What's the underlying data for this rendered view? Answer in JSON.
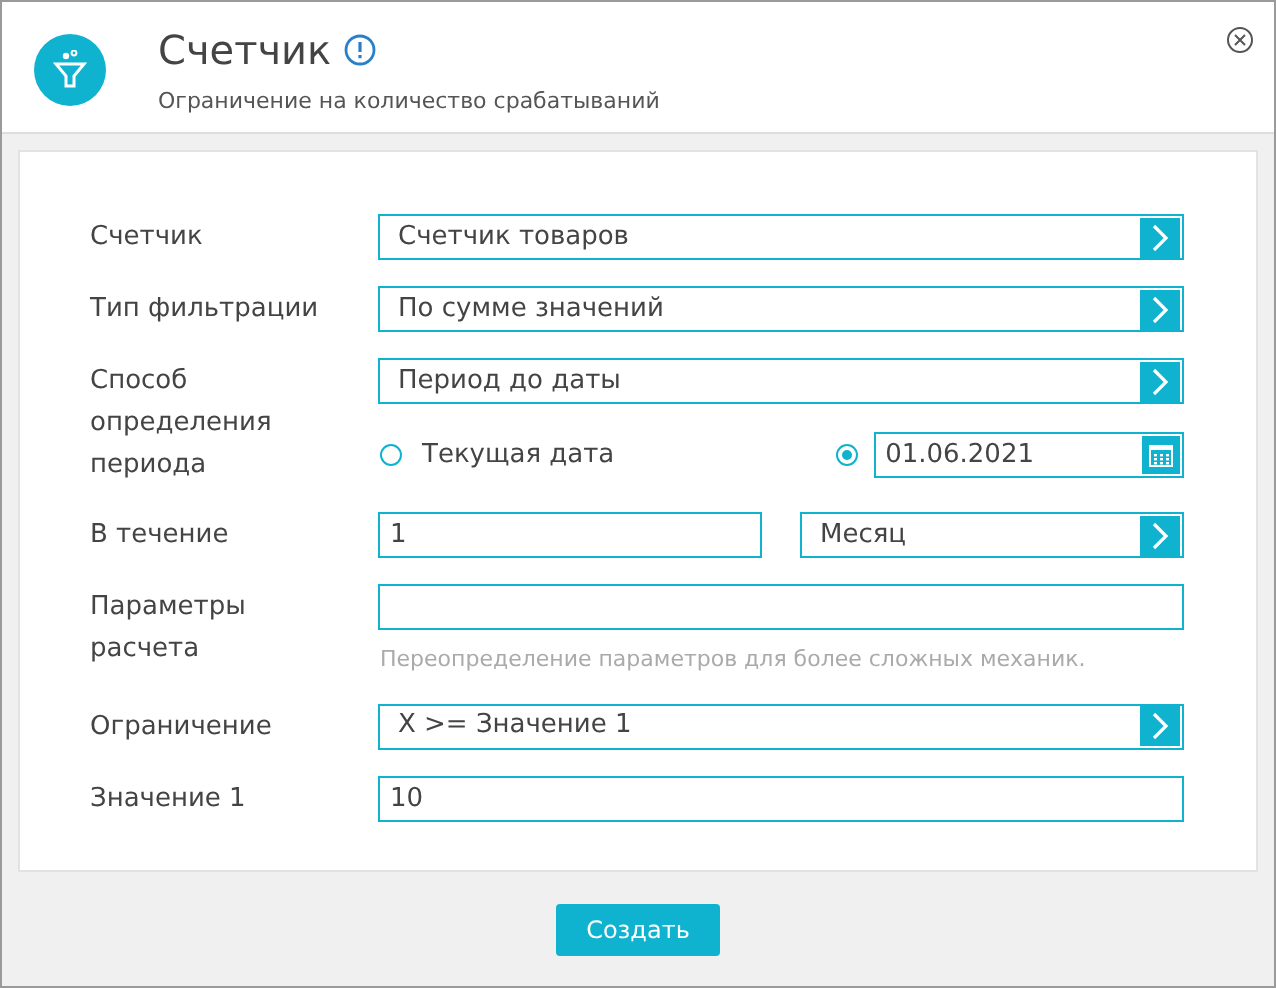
{
  "header": {
    "title": "Счетчик",
    "subtitle": "Ограничение на количество срабатываний"
  },
  "rows": [
    {
      "kind": "select",
      "label": "Счетчик",
      "value": "Счетчик товаров"
    },
    {
      "kind": "select",
      "label": "Тип фильтрации",
      "value": "По сумме значений"
    },
    {
      "kind": "period",
      "label": "Способ определения периода",
      "value": "Период до даты",
      "options": [
        {
          "label": "Текущая дата",
          "selected": false
        },
        {
          "date": "01.06.2021",
          "selected": true
        }
      ]
    },
    {
      "kind": "duration",
      "label": "В течение",
      "value": "1",
      "unit": "Месяц"
    },
    {
      "kind": "text",
      "label": "Параметры расчета",
      "hint": "Переопределение параметров для более сложных механик."
    },
    {
      "kind": "select",
      "label": "Ограничение",
      "value": "X >= Значение 1"
    },
    {
      "kind": "text",
      "label": "Значение 1",
      "value": "10"
    }
  ],
  "buttons": [
    "Создать"
  ]
}
